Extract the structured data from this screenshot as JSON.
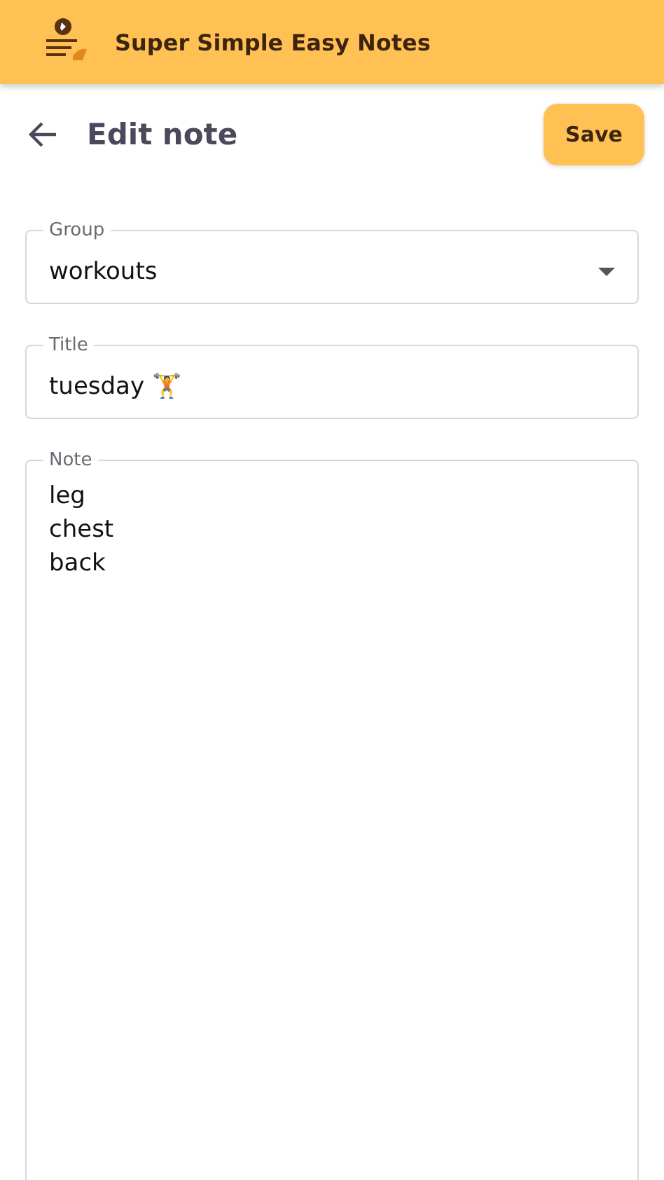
{
  "app_bar": {
    "title": "Super Simple Easy Notes"
  },
  "header": {
    "title": "Edit note",
    "save_button": "Save"
  },
  "fields": [
    {
      "kind": "dropdown",
      "label": "Group",
      "value": "workouts"
    },
    {
      "kind": "text",
      "label": "Title",
      "value": "tuesday 🏋"
    },
    {
      "kind": "multiline",
      "label": "Note",
      "value": "leg\nchest\nback"
    }
  ]
}
